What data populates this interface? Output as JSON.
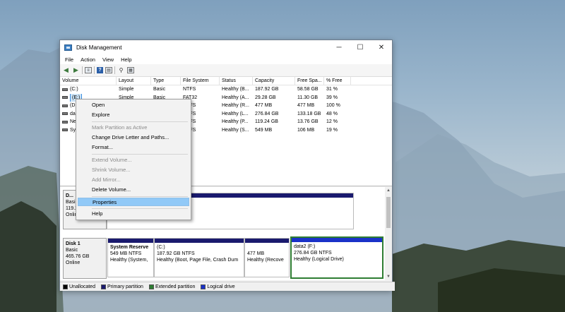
{
  "window": {
    "title": "Disk Management",
    "min": "─",
    "max": "☐",
    "close": "✕"
  },
  "menubar": [
    "File",
    "Action",
    "View",
    "Help"
  ],
  "volume_list": {
    "headers": [
      "Volume",
      "Layout",
      "Type",
      "File System",
      "Status",
      "Capacity",
      "Free Spa...",
      "% Free"
    ],
    "rows": [
      {
        "volume": "(C:)",
        "layout": "Simple",
        "type": "Basic",
        "fs": "NTFS",
        "status": "Healthy (B...",
        "capacity": "187.92 GB",
        "free": "58.58 GB",
        "pct": "31 %"
      },
      {
        "volume": "(E:)",
        "layout": "Simple",
        "type": "Basic",
        "fs": "FAT32",
        "status": "Healthy (A...",
        "capacity": "29.28 GB",
        "free": "11.30 GB",
        "pct": "39 %"
      },
      {
        "volume": "(D...",
        "layout": "",
        "type": "",
        "fs": "NTFS",
        "status": "Healthy (R...",
        "capacity": "477 MB",
        "free": "477 MB",
        "pct": "100 %"
      },
      {
        "volume": "da...",
        "layout": "",
        "type": "",
        "fs": "NTFS",
        "status": "Healthy (L...",
        "capacity": "276.84 GB",
        "free": "133.18 GB",
        "pct": "48 %"
      },
      {
        "volume": "Ne...",
        "layout": "",
        "type": "",
        "fs": "NTFS",
        "status": "Healthy (P...",
        "capacity": "119.24 GB",
        "free": "13.76 GB",
        "pct": "12 %"
      },
      {
        "volume": "Sy...",
        "layout": "",
        "type": "",
        "fs": "NTFS",
        "status": "Healthy (S...",
        "capacity": "549 MB",
        "free": "106 MB",
        "pct": "19 %"
      }
    ]
  },
  "disk0": {
    "name": "D...",
    "type": "Basic",
    "size": "119.2...",
    "state": "Online"
  },
  "disk1": {
    "name": "Disk 1",
    "type": "Basic",
    "size": "465.76 GB",
    "state": "Online",
    "partitions": [
      {
        "title": "System Reserve",
        "size": "549 MB NTFS",
        "status": "Healthy (System,"
      },
      {
        "title": "(C:)",
        "size": "187.92 GB NTFS",
        "status": "Healthy (Boot, Page File, Crash Dum"
      },
      {
        "title": "",
        "size": "477 MB",
        "status": "Healthy (Recove"
      },
      {
        "title": "data2  (F:)",
        "size": "276.84 GB NTFS",
        "status": "Healthy (Logical Drive)"
      }
    ]
  },
  "legend": [
    "Unallocated",
    "Primary partition",
    "Extended partition",
    "Logical drive"
  ],
  "legend_colors": [
    "#000000",
    "#1a1a6e",
    "#2e7d32",
    "#1a32c8"
  ],
  "context_menu": [
    {
      "label": "Open",
      "enabled": true
    },
    {
      "label": "Explore",
      "enabled": true
    },
    {
      "label": "Mark Partition as Active",
      "enabled": false
    },
    {
      "label": "Change Drive Letter and Paths...",
      "enabled": true
    },
    {
      "label": "Format...",
      "enabled": true
    },
    {
      "label": "Extend Volume...",
      "enabled": false
    },
    {
      "label": "Shrink Volume...",
      "enabled": false
    },
    {
      "label": "Add Mirror...",
      "enabled": false
    },
    {
      "label": "Delete Volume...",
      "enabled": true
    },
    {
      "label": "Properties",
      "enabled": true,
      "highlighted": true
    },
    {
      "label": "Help",
      "enabled": true
    }
  ]
}
